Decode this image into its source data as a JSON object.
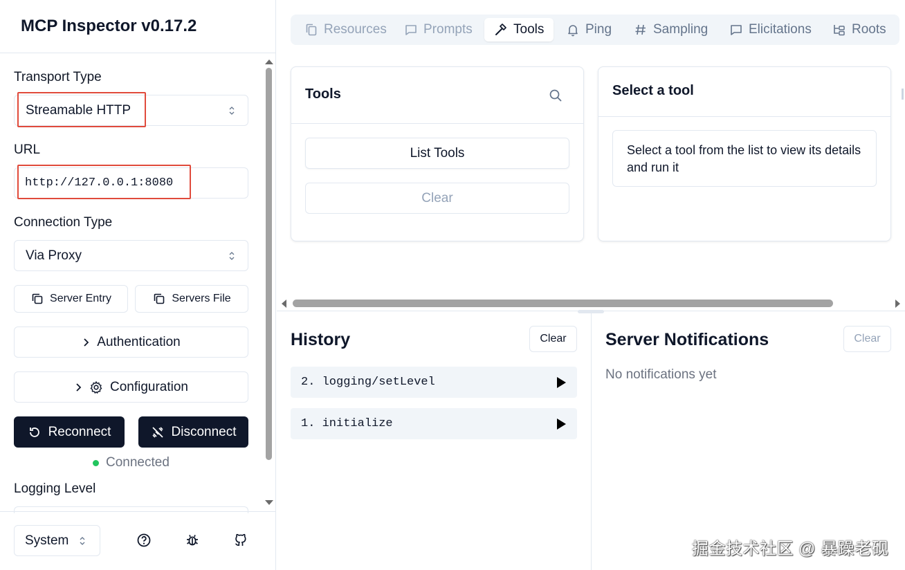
{
  "app": {
    "title": "MCP Inspector v0.17.2"
  },
  "sidebar": {
    "transport_label": "Transport Type",
    "transport_value": "Streamable HTTP",
    "url_label": "URL",
    "url_value": "http://127.0.0.1:8080",
    "connection_label": "Connection Type",
    "connection_value": "Via Proxy",
    "server_entry_label": "Server Entry",
    "servers_file_label": "Servers File",
    "authentication_label": "Authentication",
    "configuration_label": "Configuration",
    "reconnect_label": "Reconnect",
    "disconnect_label": "Disconnect",
    "status_text": "Connected",
    "status_color": "#22c55e",
    "logging_label": "Logging Level",
    "theme_value": "System",
    "highlight_color": "#e04a3b"
  },
  "tabs": [
    {
      "label": "Resources",
      "icon": "file-copy-icon",
      "state": "disabled"
    },
    {
      "label": "Prompts",
      "icon": "message-square-icon",
      "state": "disabled"
    },
    {
      "label": "Tools",
      "icon": "hammer-icon",
      "state": "active"
    },
    {
      "label": "Ping",
      "icon": "bell-icon",
      "state": "enabled"
    },
    {
      "label": "Sampling",
      "icon": "hash-icon",
      "state": "enabled"
    },
    {
      "label": "Elicitations",
      "icon": "message-square-icon",
      "state": "enabled"
    },
    {
      "label": "Roots",
      "icon": "folder-tree-icon",
      "state": "enabled"
    }
  ],
  "tools_panel": {
    "title": "Tools",
    "list_button": "List Tools",
    "clear_button": "Clear"
  },
  "detail_panel": {
    "title": "Select a tool",
    "message": "Select a tool from the list to view its details and run it"
  },
  "history": {
    "title": "History",
    "clear_button": "Clear",
    "items": [
      {
        "label": "2. logging/setLevel"
      },
      {
        "label": "1. initialize"
      }
    ]
  },
  "notifications": {
    "title": "Server Notifications",
    "clear_button": "Clear",
    "empty_text": "No notifications yet"
  },
  "watermark": "掘金技术社区 @ 暴躁老砚",
  "colors": {
    "primary_dark": "#0f172a",
    "border": "#e2e8f0",
    "tab_bg": "#f1f5f9"
  }
}
